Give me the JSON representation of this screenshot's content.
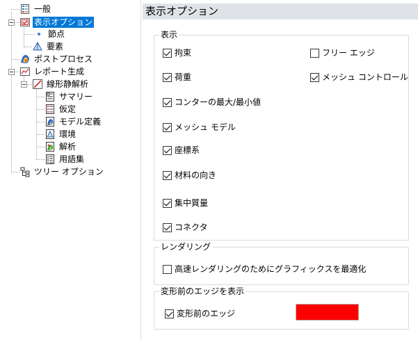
{
  "tree": {
    "items": [
      {
        "label": "一般",
        "icon": "general-icon"
      },
      {
        "label": "表示オプション",
        "icon": "display-options-icon",
        "selected": true
      },
      {
        "label": "節点",
        "icon": "node-dot-icon"
      },
      {
        "label": "要素",
        "icon": "element-icon"
      },
      {
        "label": "ポストプロセス",
        "icon": "postprocess-icon"
      },
      {
        "label": "レポート生成",
        "icon": "report-icon"
      },
      {
        "label": "線形静解析",
        "icon": "linear-static-icon"
      },
      {
        "label": "サマリー",
        "icon": "summary-icon"
      },
      {
        "label": "仮定",
        "icon": "assumptions-icon"
      },
      {
        "label": "モデル定義",
        "icon": "model-definition-icon"
      },
      {
        "label": "環境",
        "icon": "environment-icon"
      },
      {
        "label": "解析",
        "icon": "analysis-icon"
      },
      {
        "label": "用語集",
        "icon": "glossary-icon"
      },
      {
        "label": "ツリー オプション",
        "icon": "tree-options-icon"
      }
    ]
  },
  "panel": {
    "title": "表示オプション",
    "display_group": {
      "legend": "表示",
      "checkboxes": [
        {
          "label": "拘束",
          "checked": true
        },
        {
          "label": "フリー エッジ",
          "checked": false
        },
        {
          "label": "荷重",
          "checked": true
        },
        {
          "label": "メッシュ コントロール",
          "checked": true
        },
        {
          "label": "コンターの最大/最小値",
          "checked": true
        },
        {
          "label": "メッシュ モデル",
          "checked": true
        },
        {
          "label": "座標系",
          "checked": true
        },
        {
          "label": "材料の向き",
          "checked": true
        },
        {
          "label": "集中質量",
          "checked": true
        },
        {
          "label": "コネクタ",
          "checked": true
        }
      ]
    },
    "rendering_group": {
      "legend": "レンダリング",
      "checkbox": {
        "label": "高速レンダリングのためにグラフィックスを最適化",
        "checked": false
      }
    },
    "edge_group": {
      "legend": "変形前のエッジを表示",
      "checkbox": {
        "label": "変形前のエッジ",
        "checked": true
      },
      "color": "#ff0000"
    }
  }
}
